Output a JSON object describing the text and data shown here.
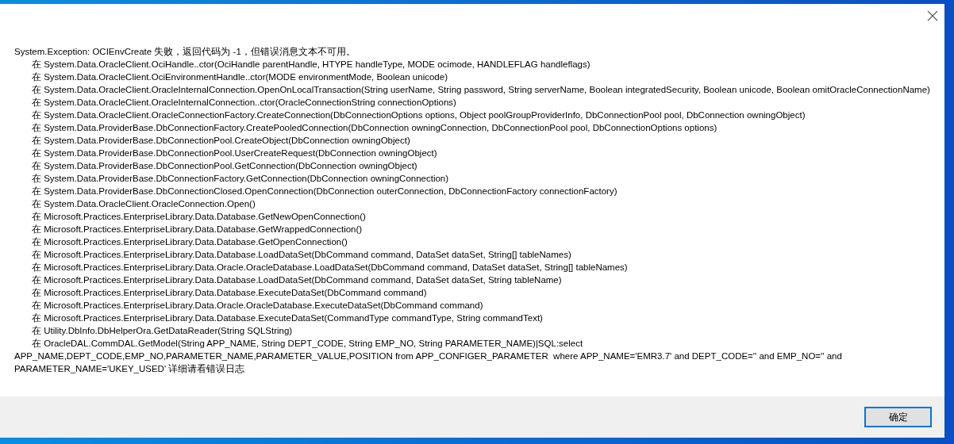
{
  "dialog": {
    "message": "System.Exception: OCIEnvCreate 失败，返回代码为 -1，但错误消息文本不可用。",
    "stack_lines": [
      "在 System.Data.OracleClient.OciHandle..ctor(OciHandle parentHandle, HTYPE handleType, MODE ocimode, HANDLEFLAG handleflags)",
      "在 System.Data.OracleClient.OciEnvironmentHandle..ctor(MODE environmentMode, Boolean unicode)",
      "在 System.Data.OracleClient.OracleInternalConnection.OpenOnLocalTransaction(String userName, String password, String serverName, Boolean integratedSecurity, Boolean unicode, Boolean omitOracleConnectionName)",
      "在 System.Data.OracleClient.OracleInternalConnection..ctor(OracleConnectionString connectionOptions)",
      "在 System.Data.OracleClient.OracleConnectionFactory.CreateConnection(DbConnectionOptions options, Object poolGroupProviderInfo, DbConnectionPool pool, DbConnection owningObject)",
      "在 System.Data.ProviderBase.DbConnectionFactory.CreatePooledConnection(DbConnection owningConnection, DbConnectionPool pool, DbConnectionOptions options)",
      "在 System.Data.ProviderBase.DbConnectionPool.CreateObject(DbConnection owningObject)",
      "在 System.Data.ProviderBase.DbConnectionPool.UserCreateRequest(DbConnection owningObject)",
      "在 System.Data.ProviderBase.DbConnectionPool.GetConnection(DbConnection owningObject)",
      "在 System.Data.ProviderBase.DbConnectionFactory.GetConnection(DbConnection owningConnection)",
      "在 System.Data.ProviderBase.DbConnectionClosed.OpenConnection(DbConnection outerConnection, DbConnectionFactory connectionFactory)",
      "在 System.Data.OracleClient.OracleConnection.Open()",
      "在 Microsoft.Practices.EnterpriseLibrary.Data.Database.GetNewOpenConnection()",
      "在 Microsoft.Practices.EnterpriseLibrary.Data.Database.GetWrappedConnection()",
      "在 Microsoft.Practices.EnterpriseLibrary.Data.Database.GetOpenConnection()",
      "在 Microsoft.Practices.EnterpriseLibrary.Data.Database.LoadDataSet(DbCommand command, DataSet dataSet, String[] tableNames)",
      "在 Microsoft.Practices.EnterpriseLibrary.Data.Oracle.OracleDatabase.LoadDataSet(DbCommand command, DataSet dataSet, String[] tableNames)",
      "在 Microsoft.Practices.EnterpriseLibrary.Data.Database.LoadDataSet(DbCommand command, DataSet dataSet, String tableName)",
      "在 Microsoft.Practices.EnterpriseLibrary.Data.Database.ExecuteDataSet(DbCommand command)",
      "在 Microsoft.Practices.EnterpriseLibrary.Data.Oracle.OracleDatabase.ExecuteDataSet(DbCommand command)",
      "在 Microsoft.Practices.EnterpriseLibrary.Data.Database.ExecuteDataSet(CommandType commandType, String commandText)",
      "在 Utility.DbInfo.DbHelperOra.GetDataReader(String SQLString)",
      "在 OracleDAL.CommDAL.GetModel(String APP_NAME, String DEPT_CODE, String EMP_NO, String PARAMETER_NAME)|SQL:select APP_NAME,DEPT_CODE,EMP_NO,PARAMETER_NAME,PARAMETER_VALUE,POSITION from APP_CONFIGER_PARAMETER  where APP_NAME='EMR3.7' and DEPT_CODE='' and EMP_NO='' and PARAMETER_NAME='UKEY_USED' 详细请看错误日志"
    ],
    "buttons": [
      {
        "label": "确定",
        "focused": true
      }
    ]
  }
}
